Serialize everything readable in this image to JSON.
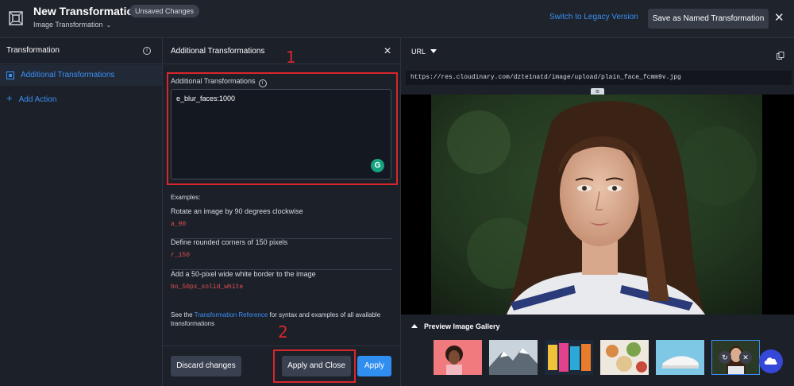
{
  "header": {
    "title": "New Transformation",
    "badge": "Unsaved Changes",
    "subtitle": "Image Transformation",
    "legacy_link": "Switch to Legacy Version",
    "save_named": "Save as Named Transformation",
    "close": "✕"
  },
  "left_panel": {
    "title": "Transformation",
    "items": [
      {
        "label": "Additional Transformations"
      }
    ],
    "add_action": "Add Action"
  },
  "middle_panel": {
    "title": "Additional Transformations",
    "close": "✕",
    "annotation_1": "1",
    "annotation_2": "2",
    "field_label": "Additional Transformations",
    "field_value": "e_blur_faces:1000",
    "examples_title": "Examples:",
    "examples": [
      {
        "description": "Rotate an image by 90 degrees clockwise",
        "code": "a_90"
      },
      {
        "description": "Define rounded corners of 150 pixels",
        "code": "r_150"
      },
      {
        "description": "Add a 50-pixel wide white border to the image",
        "code": "bo_50px_solid_white"
      }
    ],
    "footer_pre": "See the ",
    "footer_link": "Transformation Reference",
    "footer_post": " for syntax and examples of all available transformations",
    "buttons": {
      "discard": "Discard changes",
      "apply_close": "Apply and Close",
      "apply": "Apply"
    }
  },
  "right_panel": {
    "url_dropdown": "URL",
    "url": "https://res.cloudinary.com/dzte1natd/image/upload/plain_face_fcmm9v.jpg",
    "gallery_title": "Preview Image Gallery",
    "gallery_count": 6,
    "selected_index": 5
  },
  "colors": {
    "accent": "#3b8ff2",
    "annotation": "#d9262e",
    "code": "#e2504f",
    "background": "#1c2029"
  },
  "icons": [
    "logo-icon",
    "info-icon",
    "close-icon",
    "chevron-down-icon",
    "plus-icon",
    "copy-icon",
    "grammarly-icon",
    "reset-icon",
    "chat-icon"
  ]
}
